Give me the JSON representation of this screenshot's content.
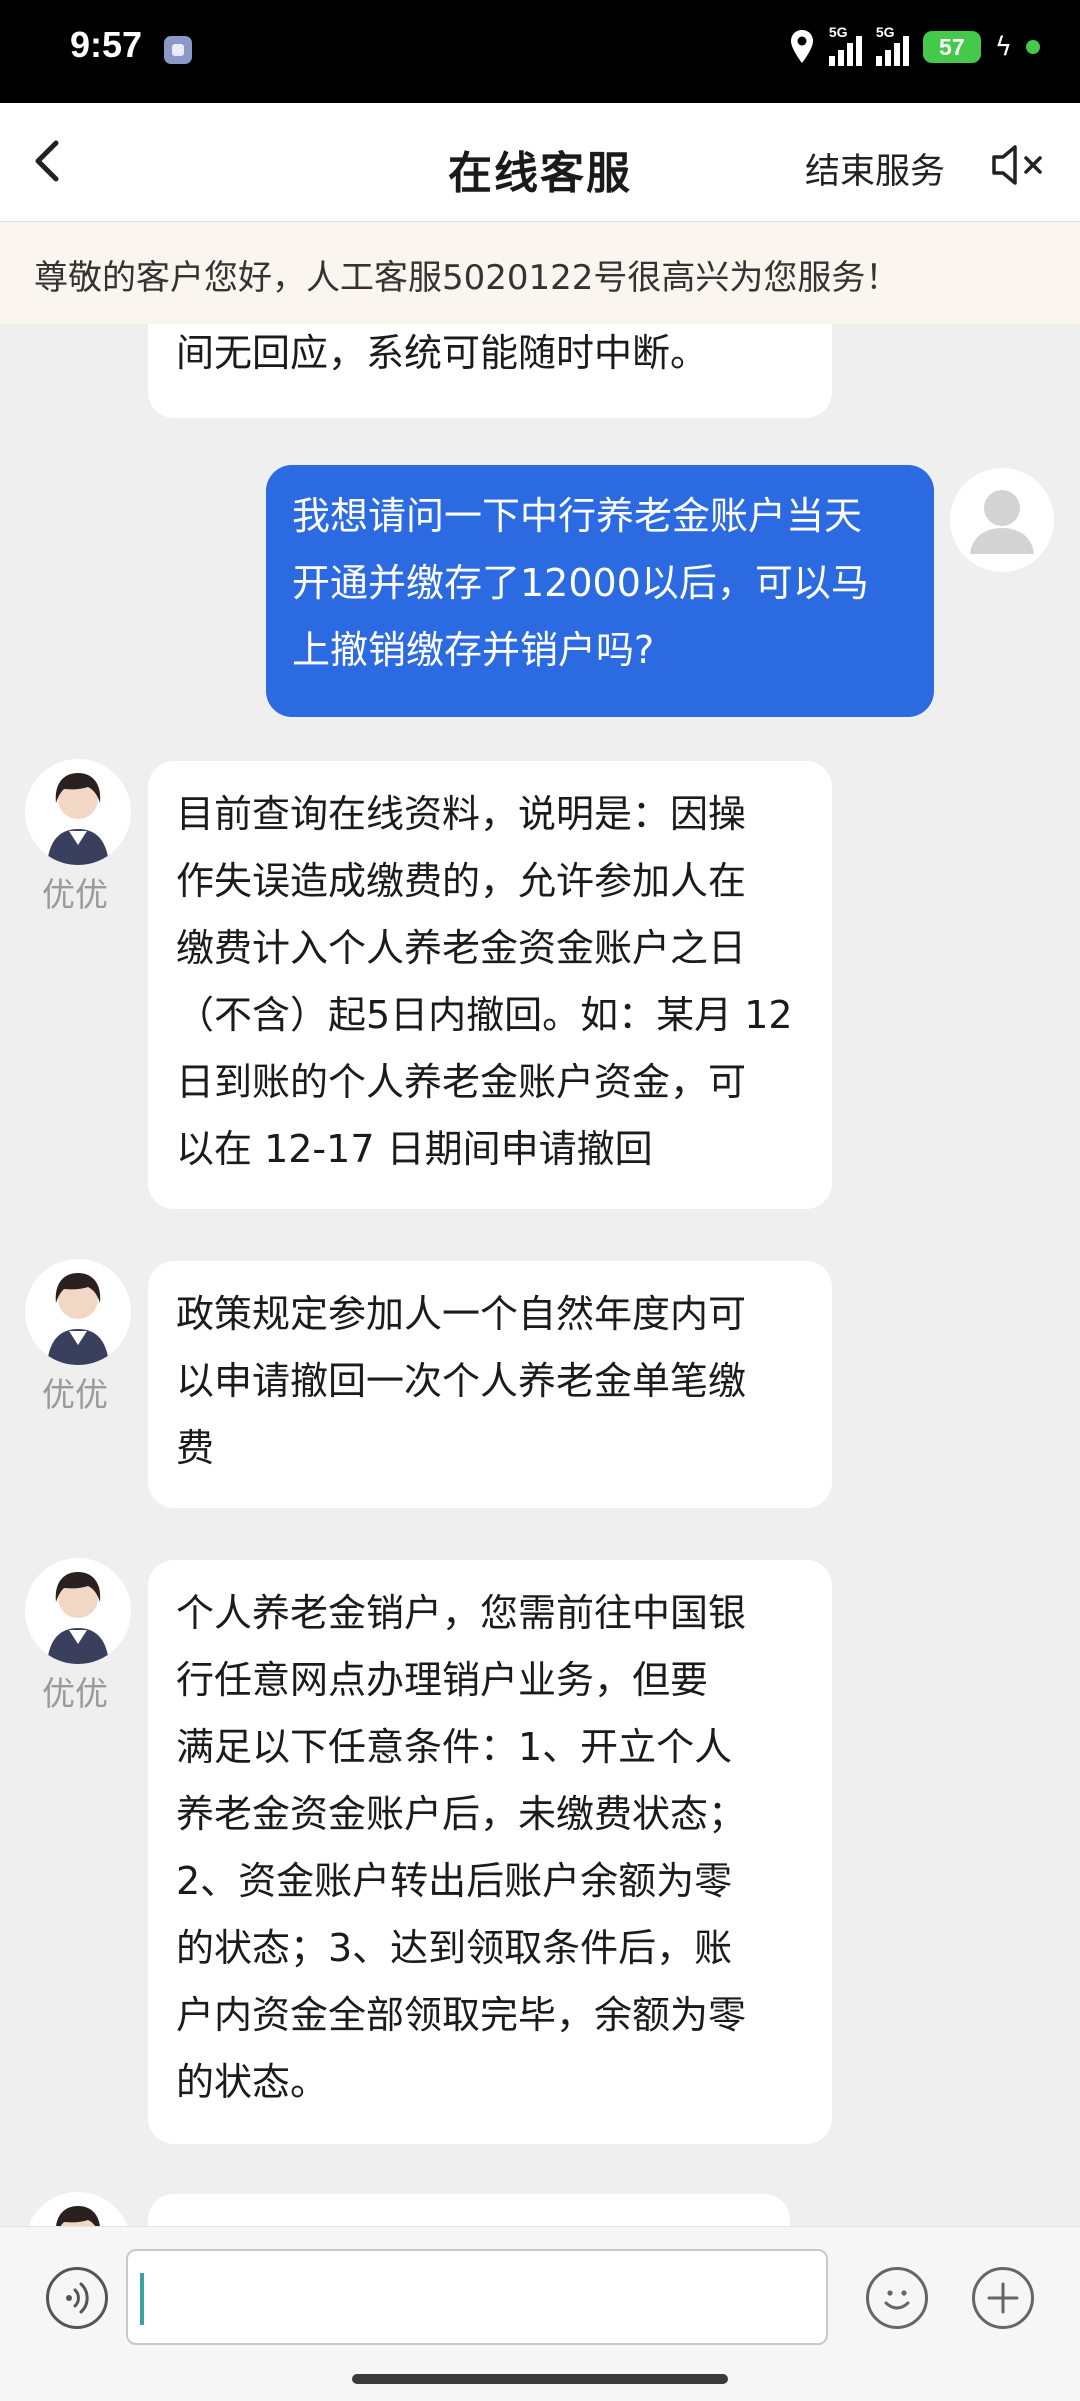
{
  "status_bar": {
    "time": "9:57",
    "signal1_label": "5G",
    "signal2_label": "5G",
    "battery": "57"
  },
  "nav": {
    "title": "在线客服",
    "end_service": "结束服务"
  },
  "notice": "尊敬的客户您好，人工客服5020122号很高兴为您服务！",
  "messages": {
    "m0": {
      "lines": [
        "间无回应，系统可能随时中断。"
      ]
    },
    "m1": {
      "lines": [
        "我想请问一下中行养老金账户当天",
        "开通并缴存了12000以后，可以马",
        "上撤销缴存并销户吗?"
      ]
    },
    "m2": {
      "name": "优优",
      "lines": [
        "目前查询在线资料，说明是：因操",
        "作失误造成缴费的，允许参加人在",
        "缴费计入个人养老金资金账户之日",
        "（不含）起5日内撤回。如：某月 12",
        "日到账的个人养老金账户资金，可",
        "以在 12-17 日期间申请撤回"
      ]
    },
    "m3": {
      "name": "优优",
      "lines": [
        "政策规定参加人一个自然年度内可",
        "以申请撤回一次个人养老金单笔缴",
        "费"
      ]
    },
    "m4": {
      "name": "优优",
      "lines": [
        "个人养老金销户，您需前往中国银",
        "行任意网点办理销户业务，但要",
        "满足以下任意条件：1、开立个人",
        "养老金资金账户后，未缴费状态；",
        "2、资金账户转出后账户余额为零",
        "的状态；3、达到领取条件后，账",
        "户内资金全部领取完毕，余额为零",
        "的状态。"
      ]
    }
  },
  "input": {
    "value": "",
    "placeholder": ""
  },
  "colors": {
    "user_bubble": "#2b6ae1",
    "accent_battery": "#44c94b",
    "notice_bg": "#faf5ee"
  }
}
